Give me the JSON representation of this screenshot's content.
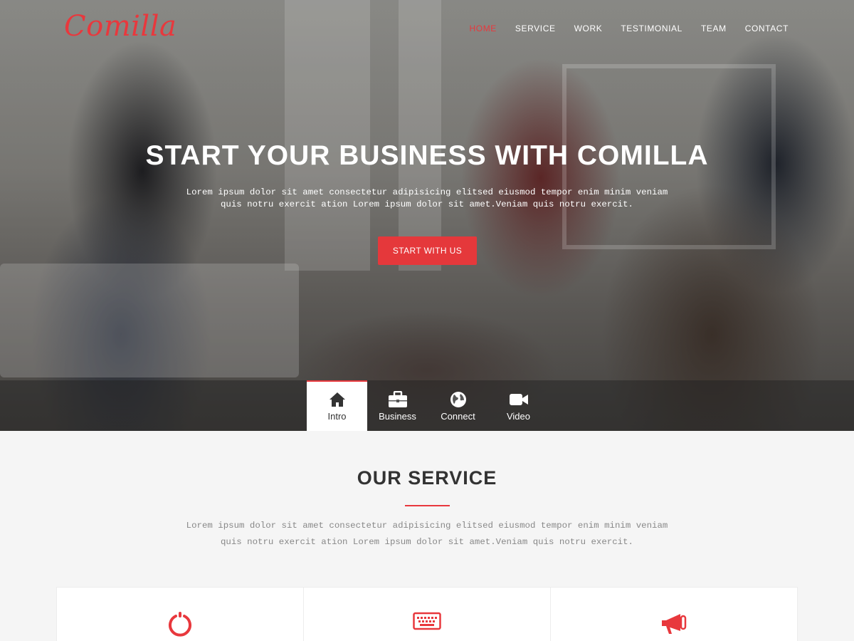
{
  "brand": {
    "logo": "Comilla",
    "accent": "#e8383d"
  },
  "nav": {
    "items": [
      {
        "label": "HOME",
        "active": true
      },
      {
        "label": "SERVICE"
      },
      {
        "label": "WORK"
      },
      {
        "label": "TESTIMONIAL"
      },
      {
        "label": "TEAM"
      },
      {
        "label": "CONTACT"
      }
    ]
  },
  "hero": {
    "title": "START YOUR BUSINESS WITH COMILLA",
    "text": "Lorem ipsum dolor sit amet consectetur adipisicing elitsed eiusmod tempor enim minim veniam quis notru exercit ation Lorem ipsum dolor sit amet.Veniam quis notru exercit.",
    "cta": "START WITH US"
  },
  "tabs": [
    {
      "label": "Intro",
      "icon": "home-icon",
      "active": true
    },
    {
      "label": "Business",
      "icon": "briefcase-icon"
    },
    {
      "label": "Connect",
      "icon": "globe-icon"
    },
    {
      "label": "Video",
      "icon": "video-camera-icon"
    }
  ],
  "service": {
    "title": "OUR SERVICE",
    "text": "Lorem ipsum dolor sit amet consectetur adipisicing elitsed eiusmod tempor enim minim veniam quis notru exercit ation Lorem ipsum dolor sit amet.Veniam quis notru exercit.",
    "cards": [
      {
        "icon": "power-ring-icon"
      },
      {
        "icon": "keyboard-icon"
      },
      {
        "icon": "megaphone-icon"
      }
    ]
  }
}
